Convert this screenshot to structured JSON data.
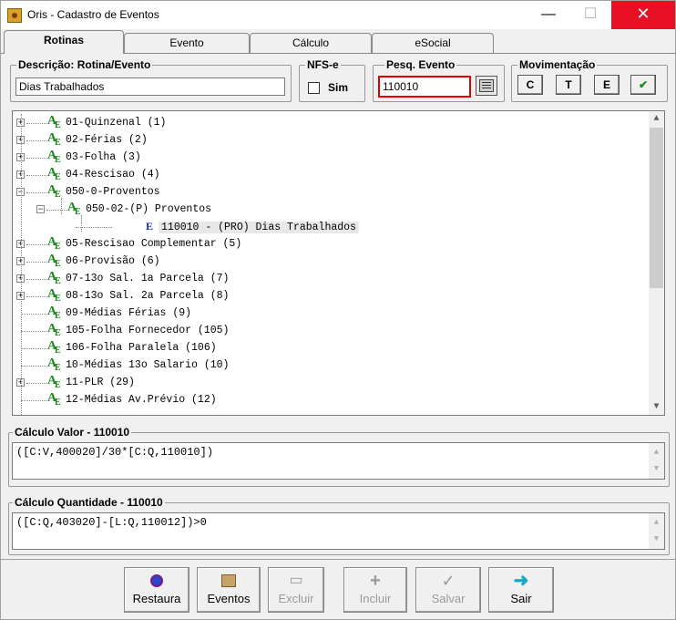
{
  "window": {
    "title": "Oris - Cadastro de Eventos",
    "controls": {
      "minimize": "—",
      "maximize": "☐",
      "close": "✕"
    }
  },
  "tabs": [
    "Rotinas",
    "Evento",
    "Cálculo",
    "eSocial"
  ],
  "descricao": {
    "label": "Descrição: Rotina/Evento",
    "value": "Dias Trabalhados"
  },
  "nfse": {
    "label": "NFS-e",
    "checkbox_label": "Sim",
    "checked": false
  },
  "pesq": {
    "label": "Pesq. Evento",
    "value": "110010",
    "button_icon": "search-list-icon"
  },
  "movimentacao": {
    "label": "Movimentação",
    "buttons": [
      "C",
      "T",
      "E",
      "✔"
    ]
  },
  "tree": {
    "items": [
      {
        "text": "01-Quinzenal (1)",
        "level": 0,
        "expander": "+"
      },
      {
        "text": "02-Férias (2)",
        "level": 0,
        "expander": "+"
      },
      {
        "text": "03-Folha (3)",
        "level": 0,
        "expander": "+"
      },
      {
        "text": "04-Rescisao (4)",
        "level": 0,
        "expander": "+"
      },
      {
        "text": "050-0-Proventos",
        "level": 0,
        "expander": "−"
      },
      {
        "text": "050-02-(P) Proventos",
        "level": 1,
        "expander": "−"
      },
      {
        "text": "110010 - (PRO) Dias Trabalhados",
        "level": 2,
        "expander": ""
      },
      {
        "text": "05-Rescisao Complementar (5)",
        "level": 0,
        "expander": "+"
      },
      {
        "text": "06-Provisão (6)",
        "level": 0,
        "expander": "+"
      },
      {
        "text": "07-13o Sal. 1a Parcela (7)",
        "level": 0,
        "expander": "+"
      },
      {
        "text": "08-13o Sal. 2a Parcela (8)",
        "level": 0,
        "expander": "+"
      },
      {
        "text": "09-Médias Férias (9)",
        "level": 0,
        "expander": ""
      },
      {
        "text": "105-Folha Fornecedor (105)",
        "level": 0,
        "expander": ""
      },
      {
        "text": "106-Folha Paralela (106)",
        "level": 0,
        "expander": ""
      },
      {
        "text": "10-Médias 13o Salario (10)",
        "level": 0,
        "expander": ""
      },
      {
        "text": "11-PLR (29)",
        "level": 0,
        "expander": "+"
      },
      {
        "text": "12-Médias Av.Prévio (12)",
        "level": 0,
        "expander": ""
      }
    ]
  },
  "calculo_valor": {
    "label": "Cálculo Valor - 110010",
    "formula": "([C:V,400020]/30*[C:Q,110010])"
  },
  "calculo_quantidade": {
    "label": "Cálculo Quantidade - 110010",
    "formula": "([C:Q,403020]-[L:Q,110012])>0"
  },
  "actions": [
    {
      "label": "Restaura",
      "icon": "restore-icon",
      "enabled": true
    },
    {
      "label": "Eventos",
      "icon": "events-icon",
      "enabled": true
    },
    {
      "label": "Excluir",
      "icon": "delete-icon",
      "enabled": false
    },
    {
      "label": "Incluir",
      "icon": "add-icon",
      "enabled": false
    },
    {
      "label": "Salvar",
      "icon": "save-icon",
      "enabled": false
    },
    {
      "label": "Sair",
      "icon": "exit-arrow-icon",
      "enabled": true
    }
  ],
  "colors": {
    "close_button": "#e81123",
    "highlight_border": "#e00000",
    "tree_icon": "#1a8a1a",
    "event_icon": "#1030c0"
  }
}
